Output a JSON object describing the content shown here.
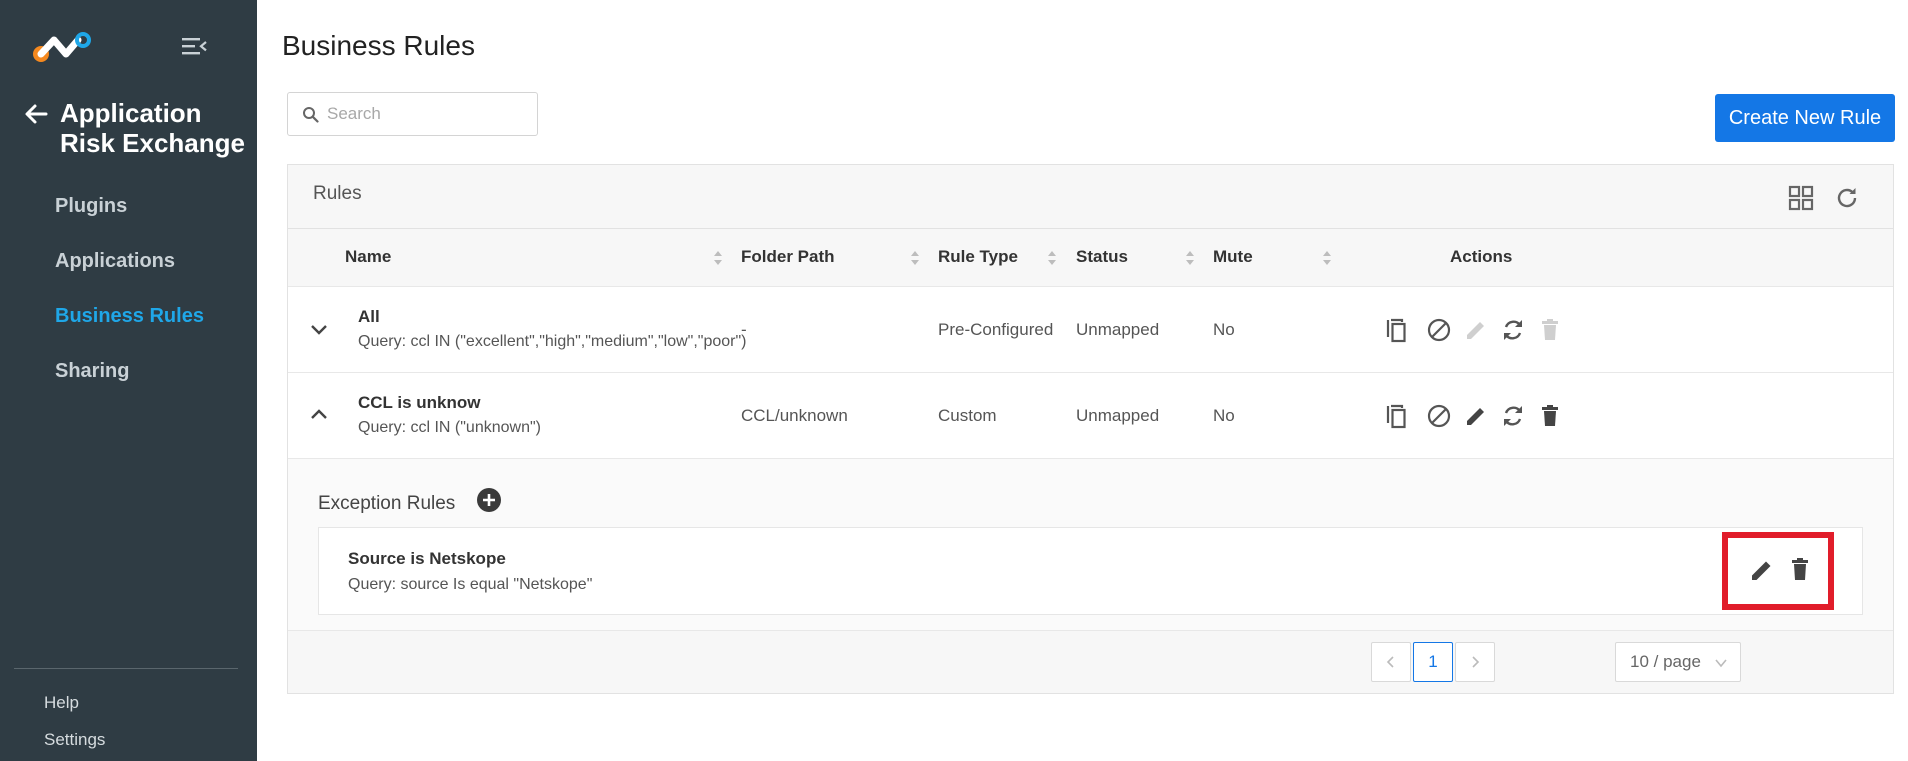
{
  "sidebar": {
    "app_title": "Application Risk Exchange",
    "nav": [
      {
        "label": "Plugins"
      },
      {
        "label": "Applications"
      },
      {
        "label": "Business Rules"
      },
      {
        "label": "Sharing"
      }
    ],
    "active_index": 2,
    "help_label": "Help",
    "settings_label": "Settings"
  },
  "page": {
    "title": "Business Rules",
    "search_placeholder": "Search",
    "create_button": "Create New Rule"
  },
  "panel": {
    "title": "Rules",
    "columns": [
      "Name",
      "Folder Path",
      "Rule Type",
      "Status",
      "Mute",
      "Actions"
    ],
    "rows": [
      {
        "name": "All",
        "query": "Query: ccl IN (\"excellent\",\"high\",\"medium\",\"low\",\"poor\")",
        "folder": "-",
        "type": "Pre-Configured",
        "status": "Unmapped",
        "mute": "No",
        "expanded": false,
        "edit_enabled": false,
        "delete_enabled": false
      },
      {
        "name": "CCL is unknow",
        "query": "Query: ccl IN (\"unknown\")",
        "folder": "CCL/unknown",
        "type": "Custom",
        "status": "Unmapped",
        "mute": "No",
        "expanded": true,
        "edit_enabled": true,
        "delete_enabled": true
      }
    ],
    "exception_rules": {
      "title": "Exception Rules",
      "items": [
        {
          "name": "Source is Netskope",
          "query": "Query: source Is equal \"Netskope\""
        }
      ]
    },
    "pagination": {
      "current_page": "1",
      "page_size": "10 / page"
    }
  },
  "colors": {
    "sidebar_bg": "#2f3c44",
    "accent": "#1477e6",
    "active_nav": "#1fa7e8",
    "highlight": "#e11d2a"
  }
}
